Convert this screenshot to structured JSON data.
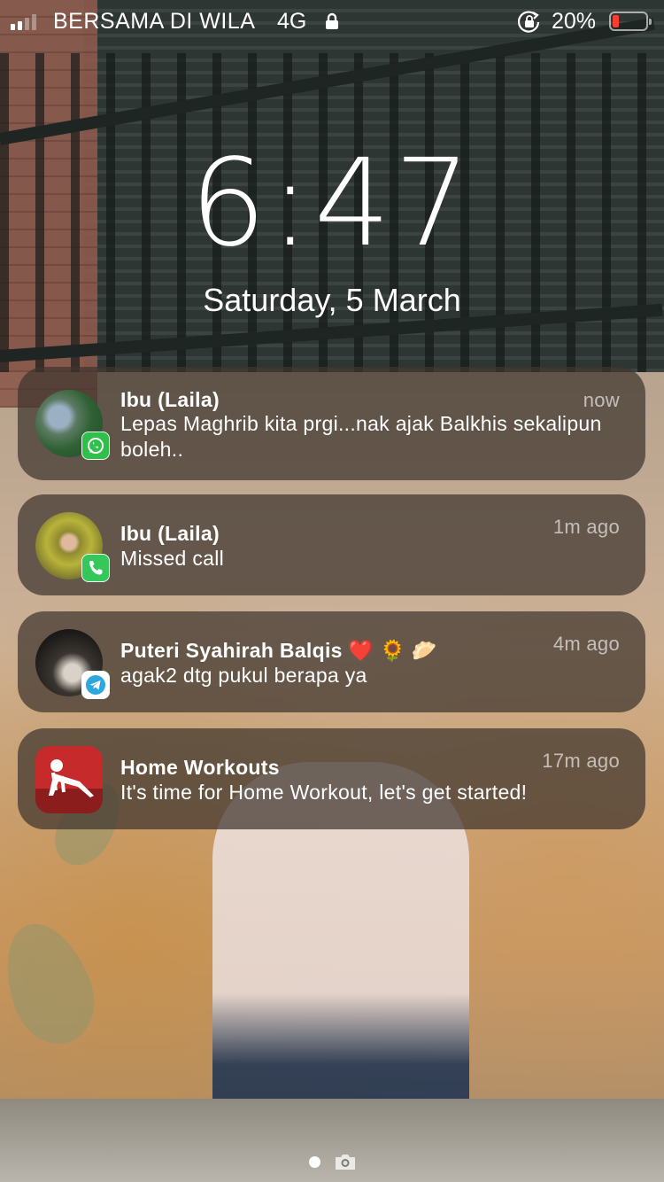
{
  "status_bar": {
    "carrier": "BERSAMA DI WILA",
    "network": "4G",
    "battery_percent": "20%",
    "battery_level": 0.2,
    "icons": [
      "signal-bars-icon",
      "lock-icon",
      "orientation-lock-icon",
      "battery-icon"
    ]
  },
  "lockscreen": {
    "time": "6:47",
    "date": "Saturday, 5 March"
  },
  "notifications": [
    {
      "sender": "Ibu (Laila)",
      "message": "Lepas Maghrib kita prgi...nak ajak Balkhis sekalipun boleh..",
      "time": "now",
      "app_badge": "whatsapp-icon"
    },
    {
      "sender": "Ibu (Laila)",
      "message": "Missed call",
      "time": "1m ago",
      "app_badge": "phone-icon"
    },
    {
      "sender": "Puteri Syahirah Balqis ❤️ 🌻 🥟",
      "message": "agak2 dtg pukul berapa ya",
      "time": "4m ago",
      "app_badge": "telegram-icon"
    },
    {
      "sender": "Home Workouts",
      "message": "It's time for Home Workout, let's get started!",
      "time": "17m ago",
      "app_badge": "home-workouts-icon"
    }
  ],
  "bottom": {
    "icons": [
      "page-dot",
      "camera-icon"
    ]
  },
  "colors": {
    "battery_low": "#ff3b30",
    "whatsapp": "#2fbf4a",
    "phone": "#35c759",
    "telegram": "#2ea6de",
    "home_workouts": "#c62a2a",
    "notification_bg": "rgba(62,52,46,0.72)"
  }
}
